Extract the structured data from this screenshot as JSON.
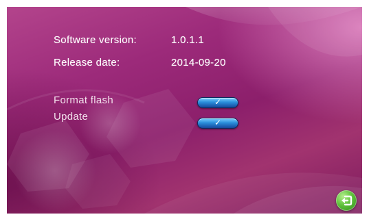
{
  "info": {
    "software_version_label": "Software version:",
    "software_version_value": "1.0.1.1",
    "release_date_label": "Release date:",
    "release_date_value": "2014-09-20"
  },
  "actions": {
    "format_flash_label": "Format flash",
    "update_label": "Update",
    "confirm_glyph": "✓"
  },
  "icons": {
    "confirm": "check-icon",
    "back": "return-icon"
  },
  "colors": {
    "background": "#9c2a7a",
    "button_blue": "#2a8fdc",
    "back_green": "#5ec13a"
  }
}
